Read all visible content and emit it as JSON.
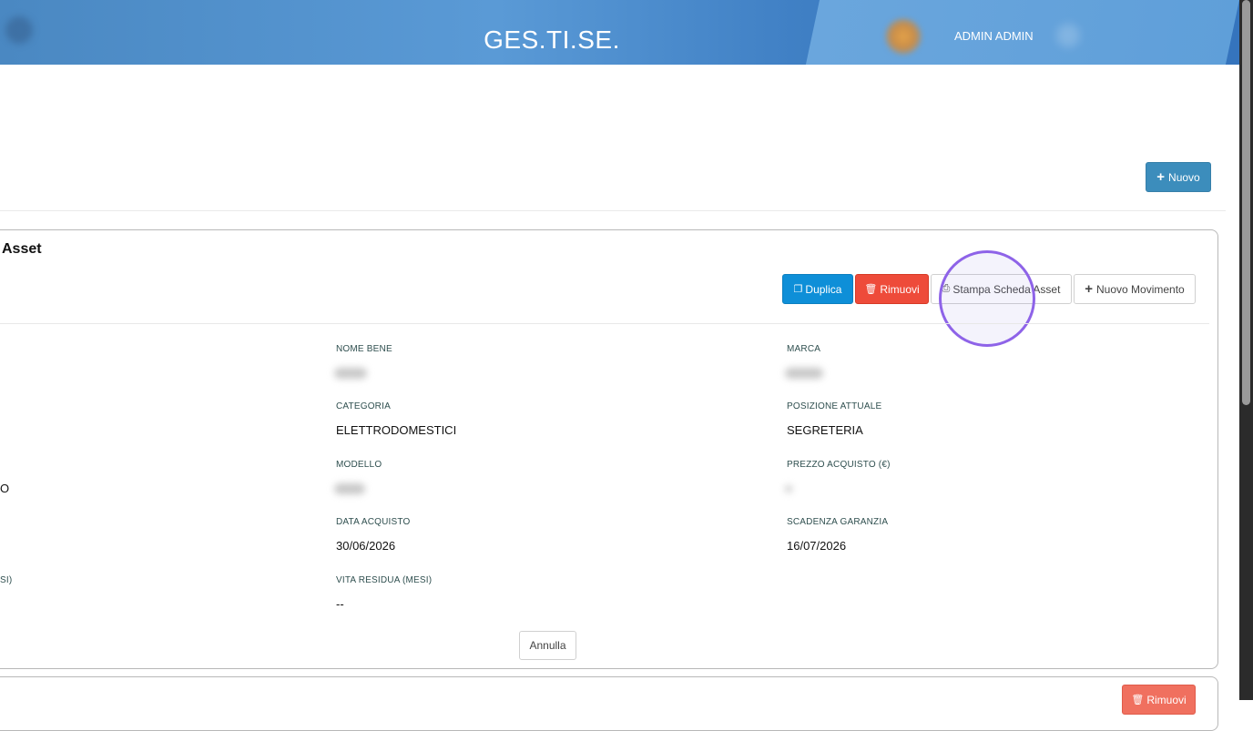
{
  "header": {
    "app_title": "GES.TI.SE.",
    "user_name": "ADMIN ADMIN"
  },
  "toolbar": {
    "new_label": "Nuovo"
  },
  "card": {
    "title": "Asset",
    "actions": {
      "duplicate": "Duplica",
      "remove": "Rimuovi",
      "print": "Stampa Scheda Asset",
      "new_movement": "Nuovo Movimento"
    },
    "fields": {
      "nome_bene": {
        "label": "NOME BENE",
        "value": ""
      },
      "marca": {
        "label": "MARCA",
        "value": ""
      },
      "categoria": {
        "label": "CATEGORIA",
        "value": "ELETTRODOMESTICI"
      },
      "posizione": {
        "label": "POSIZIONE ATTUALE",
        "value": "SEGRETERIA"
      },
      "modello": {
        "label": "MODELLO",
        "value": ""
      },
      "prezzo": {
        "label": "PREZZO ACQUISTO (€)",
        "value": ""
      },
      "data_acquisto": {
        "label": "DATA ACQUISTO",
        "value": "30/06/2026"
      },
      "scadenza": {
        "label": "SCADENZA GARANZIA",
        "value": "16/07/2026"
      },
      "vita_residua": {
        "label": "VITA RESIDUA (MESI)",
        "value": "--"
      }
    },
    "left_fragments": {
      "row3_value": "O",
      "row5_label": "SI)"
    },
    "cancel": "Annulla"
  },
  "card2": {
    "remove": "Rimuovi"
  },
  "colors": {
    "header": "#4a88c2",
    "primary": "#3c8dbc",
    "info": "#0e8fd8",
    "danger": "#ee4b3a",
    "highlight_ring": "#8e63e8"
  }
}
